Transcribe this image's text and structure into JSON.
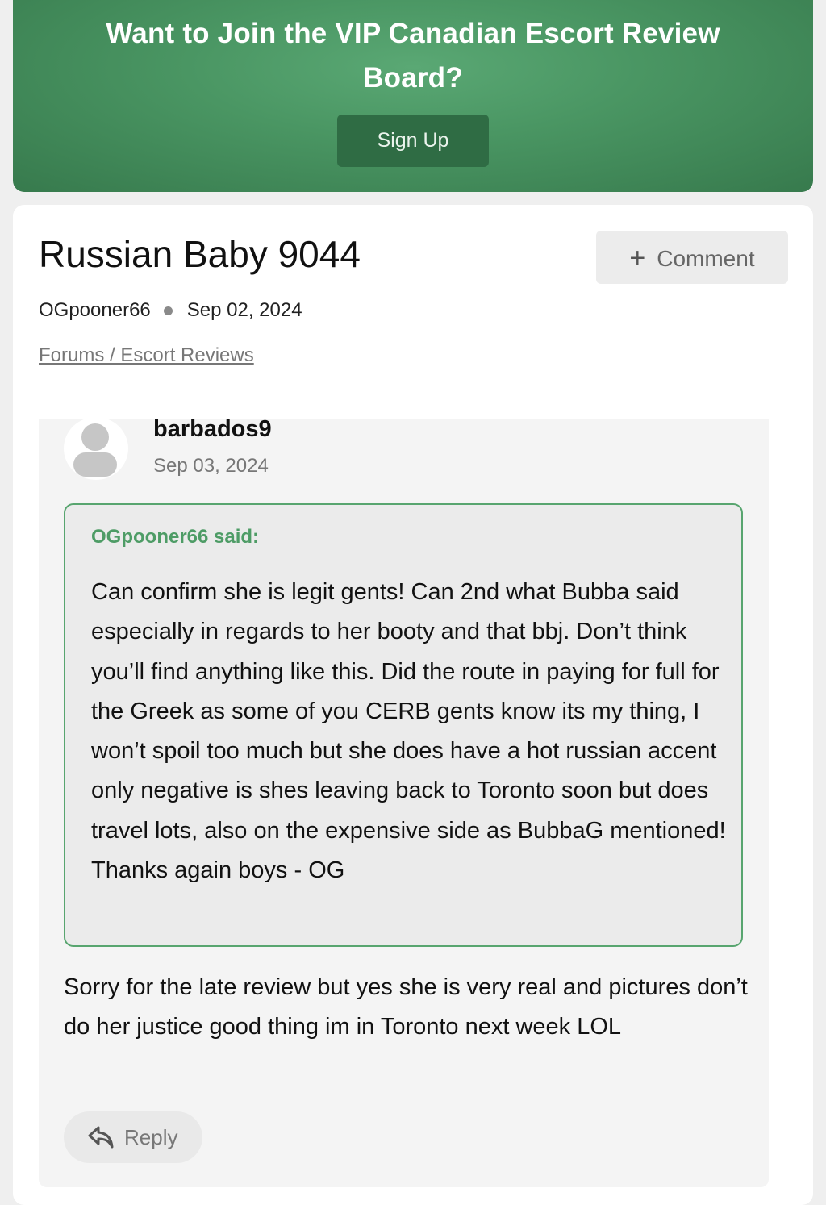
{
  "banner": {
    "title": "Want to Join the VIP Canadian Escort Review Board?",
    "signup_label": "Sign Up"
  },
  "thread": {
    "title": "Russian Baby 9044",
    "comment_label": "Comment",
    "author": "OGpooner66",
    "date": "Sep 02, 2024",
    "breadcrumb": "Forums / Escort Reviews"
  },
  "post": {
    "author": "barbados9",
    "date": "Sep 03, 2024",
    "quote_author": "OGpooner66 said:",
    "quote_text": "Can confirm she is legit gents! Can 2nd what Bubba said especially in regards to her booty and that bbj. Don’t think you’ll find anything like this. Did the route in paying for full for the Greek as some of you CERB gents know its my thing, I won’t spoil too much but she does have a hot russian accent only negative is shes leaving back to Toronto soon but does travel lots, also on the expensive side as BubbaG mentioned! Thanks again boys - OG",
    "body": "Sorry for the late review but yes she is very real and pictures don’t do her justice good thing im in Toronto next week LOL",
    "reply_label": "Reply"
  },
  "icons": {
    "comment": "plus-icon",
    "reply": "reply-arrow-icon",
    "avatar": "default-user-avatar-icon"
  },
  "colors": {
    "brand_green": "#4a9663",
    "button_dark_green": "#2f6c44",
    "quote_border": "#58a56f",
    "quote_author": "#4e9c66"
  }
}
